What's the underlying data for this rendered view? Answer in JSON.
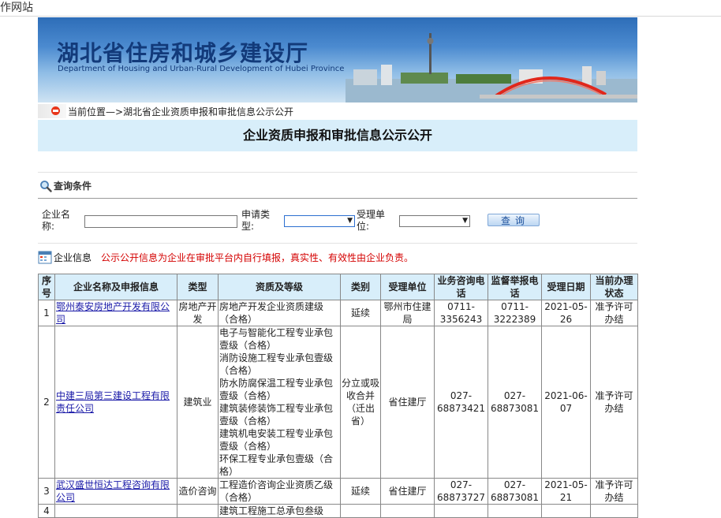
{
  "window": {
    "title": "工作网站"
  },
  "banner": {
    "title_cn": "湖北省住房和城乡建设厅",
    "title_en": "Department of Housing and Urban-Rural Development of Hubei Province"
  },
  "breadcrumb": {
    "text": "当前位置—>湖北省企业资质申报和审批信息公示公开"
  },
  "page": {
    "heading": "企业资质申报和审批信息公示公开"
  },
  "query": {
    "section_label": "查询条件",
    "company_label": "企业名称:",
    "apply_type_label": "申请类型:",
    "unit_label": "受理单位:",
    "company_value": "",
    "apply_type_value": "",
    "unit_value": "",
    "submit_label": "查询"
  },
  "info": {
    "section_label": "企业信息",
    "notice": "公示公开信息为企业在审批平台内自行填报，真实性、有效性由企业负责。"
  },
  "table": {
    "headers": [
      "序号",
      "企业名称及申报信息",
      "类型",
      "资质及等级",
      "类别",
      "受理单位",
      "业务咨询电话",
      "监督举报电话",
      "受理日期",
      "当前办理状态"
    ],
    "rows": [
      {
        "no": "1",
        "company": "鄂州泰安房地产开发有限公司",
        "type": "房地产开发",
        "quals": [
          "房地产开发企业资质建级（合格）"
        ],
        "category": "延续",
        "unit": "鄂州市住建局",
        "phone": "0711-3356243",
        "report": "0711-3222389",
        "date": "2021-05-26",
        "status": "准予许可办结"
      },
      {
        "no": "2",
        "company": "中建三局第三建设工程有限责任公司",
        "type": "建筑业",
        "quals": [
          "电子与智能化工程专业承包壹级（合格）",
          "消防设施工程专业承包壹级（合格）",
          "防水防腐保温工程专业承包壹级（合格）",
          "建筑装修装饰工程专业承包壹级（合格）",
          "建筑机电安装工程专业承包壹级（合格）",
          "环保工程专业承包壹级（合格）"
        ],
        "category": "分立或吸收合并（迁出省）",
        "unit": "省住建厅",
        "phone": "027-68873421",
        "report": "027-68873081",
        "date": "2021-06-07",
        "status": "准予许可办结"
      },
      {
        "no": "3",
        "company": "武汉盛世恒达工程咨询有限公司",
        "type": "造价咨询",
        "quals": [
          "工程造价咨询企业资质乙级（合格）"
        ],
        "category": "延续",
        "unit": "省住建厅",
        "phone": "027-68873727",
        "report": "027-68873081",
        "date": "2021-05-21",
        "status": "准予许可办结"
      },
      {
        "no": "4",
        "company": "",
        "type": "",
        "quals": [
          "建筑工程施工总承包叁级"
        ],
        "category": "",
        "unit": "",
        "phone": "",
        "report": "",
        "date": "",
        "status": ""
      }
    ]
  }
}
